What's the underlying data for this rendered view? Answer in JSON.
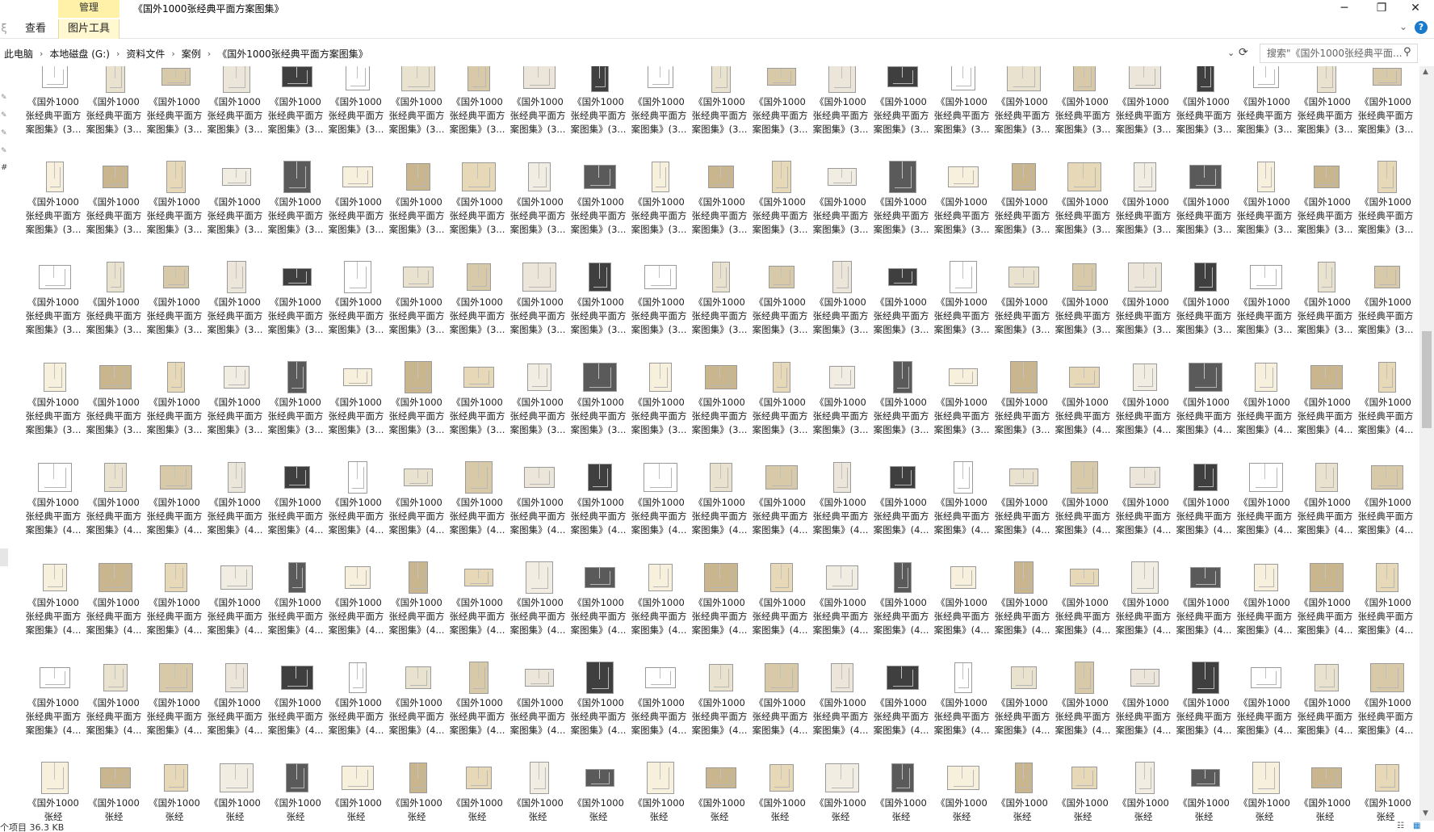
{
  "window": {
    "context_tab": "管理",
    "title": "《国外1000张经典平面方案图集》",
    "minimize": "─",
    "restore": "❐",
    "close": "✕"
  },
  "ribbon": {
    "left_fragment": "ξ",
    "tabs": [
      {
        "label": "查看"
      },
      {
        "label": "图片工具"
      }
    ],
    "expand_glyph": "⌄",
    "help_glyph": "?"
  },
  "address": {
    "crumbs": [
      "此电脑",
      "本地磁盘 (G:)",
      "资料文件",
      "案例",
      "《国外1000张经典平面方案图集》"
    ],
    "separator": "›",
    "dropdown_glyph": "⌄",
    "refresh_glyph": "⟳"
  },
  "search": {
    "placeholder": "搜索\"《国外1000张经典平面...",
    "icon": "⚲"
  },
  "navpane": {
    "pin_glyph": "✎",
    "fragment": "#"
  },
  "gallery": {
    "rows": [
      {
        "captions": [
          "《国外1000张经典平面方案图集》(3...",
          "《国外1000张经典平面方案图集》(3...",
          "《国外1000张经典平面方案图集》(3...",
          "《国外1000张经典平面方案图集》(3...",
          "《国外1000张经典平面方案图集》(3...",
          "《国外1000张经典平面方案图集》(3...",
          "《国外1000张经典平面方案图集》(3...",
          "《国外1000张经典平面方案图集》(3...",
          "《国外1000张经典平面方案图集》(3...",
          "《国外1000张经典平面方案图集》(3...",
          "《国外1000张经典平面方案图集》(3...",
          "《国外1000张经典平面方案图集》(3...",
          "《国外1000张经典平面方案图集》(3...",
          "《国外1000张经典平面方案图集》(3...",
          "《国外1000张经典平面方案图集》(3...",
          "《国外1000张经典平面方案图集》(3...",
          "《国外1000张经典平面方案图集》(3...",
          "《国外1000张经典平面方案图集》(3...",
          "《国外1000张经典平面方案图集》(3...",
          "《国外1000张经典平面方案图集》(3...",
          "《国外1000张经典平面方案图集》(3...",
          "《国外1000张经典平面方案图集》(3...",
          "《国外1000张经典平面方案图集》(3...",
          "《国外1000张经典平面方案图集》(3..."
        ]
      },
      {
        "captions": [
          "《国外1000张经典平面方案图集》(3...",
          "《国外1000张经典平面方案图集》(3...",
          "《国外1000张经典平面方案图集》(3...",
          "《国外1000张经典平面方案图集》(3...",
          "《国外1000张经典平面方案图集》(3...",
          "《国外1000张经典平面方案图集》(3...",
          "《国外1000张经典平面方案图集》(3...",
          "《国外1000张经典平面方案图集》(3...",
          "《国外1000张经典平面方案图集》(3...",
          "《国外1000张经典平面方案图集》(3...",
          "《国外1000张经典平面方案图集》(3...",
          "《国外1000张经典平面方案图集》(3...",
          "《国外1000张经典平面方案图集》(3...",
          "《国外1000张经典平面方案图集》(3...",
          "《国外1000张经典平面方案图集》(3...",
          "《国外1000张经典平面方案图集》(3...",
          "《国外1000张经典平面方案图集》(3...",
          "《国外1000张经典平面方案图集》(3...",
          "《国外1000张经典平面方案图集》(3...",
          "《国外1000张经典平面方案图集》(3...",
          "《国外1000张经典平面方案图集》(3...",
          "《国外1000张经典平面方案图集》(3...",
          "《国外1000张经典平面方案图集》(3...",
          "《国外1000张经典平面方案图集》(3..."
        ]
      },
      {
        "captions": [
          "《国外1000张经典平面方案图集》(3...",
          "《国外1000张经典平面方案图集》(3...",
          "《国外1000张经典平面方案图集》(3...",
          "《国外1000张经典平面方案图集》(3...",
          "《国外1000张经典平面方案图集》(3...",
          "《国外1000张经典平面方案图集》(3...",
          "《国外1000张经典平面方案图集》(3...",
          "《国外1000张经典平面方案图集》(3...",
          "《国外1000张经典平面方案图集》(3...",
          "《国外1000张经典平面方案图集》(3...",
          "《国外1000张经典平面方案图集》(3...",
          "《国外1000张经典平面方案图集》(3...",
          "《国外1000张经典平面方案图集》(3...",
          "《国外1000张经典平面方案图集》(3...",
          "《国外1000张经典平面方案图集》(3...",
          "《国外1000张经典平面方案图集》(3...",
          "《国外1000张经典平面方案图集》(3...",
          "《国外1000张经典平面方案图集》(3...",
          "《国外1000张经典平面方案图集》(3...",
          "《国外1000张经典平面方案图集》(3...",
          "《国外1000张经典平面方案图集》(3...",
          "《国外1000张经典平面方案图集》(3...",
          "《国外1000张经典平面方案图集》(3...",
          "《国外1000张经典平面方案图集》(3..."
        ]
      },
      {
        "captions": [
          "《国外1000张经典平面方案图集》(3...",
          "《国外1000张经典平面方案图集》(3...",
          "《国外1000张经典平面方案图集》(3...",
          "《国外1000张经典平面方案图集》(3...",
          "《国外1000张经典平面方案图集》(3...",
          "《国外1000张经典平面方案图集》(3...",
          "《国外1000张经典平面方案图集》(3...",
          "《国外1000张经典平面方案图集》(3...",
          "《国外1000张经典平面方案图集》(3...",
          "《国外1000张经典平面方案图集》(3...",
          "《国外1000张经典平面方案图集》(3...",
          "《国外1000张经典平面方案图集》(3...",
          "《国外1000张经典平面方案图集》(3...",
          "《国外1000张经典平面方案图集》(3...",
          "《国外1000张经典平面方案图集》(3...",
          "《国外1000张经典平面方案图集》(3...",
          "《国外1000张经典平面方案图集》(3...",
          "《国外1000张经典平面方案图集》(4...",
          "《国外1000张经典平面方案图集》(4...",
          "《国外1000张经典平面方案图集》(4...",
          "《国外1000张经典平面方案图集》(4...",
          "《国外1000张经典平面方案图集》(4...",
          "《国外1000张经典平面方案图集》(4...",
          "《国外1000张经典平面方案图集》(4..."
        ]
      },
      {
        "captions": [
          "《国外1000张经典平面方案图集》(4...",
          "《国外1000张经典平面方案图集》(4...",
          "《国外1000张经典平面方案图集》(4...",
          "《国外1000张经典平面方案图集》(4...",
          "《国外1000张经典平面方案图集》(4...",
          "《国外1000张经典平面方案图集》(4...",
          "《国外1000张经典平面方案图集》(4...",
          "《国外1000张经典平面方案图集》(4...",
          "《国外1000张经典平面方案图集》(4...",
          "《国外1000张经典平面方案图集》(4...",
          "《国外1000张经典平面方案图集》(4...",
          "《国外1000张经典平面方案图集》(4...",
          "《国外1000张经典平面方案图集》(4...",
          "《国外1000张经典平面方案图集》(4...",
          "《国外1000张经典平面方案图集》(4...",
          "《国外1000张经典平面方案图集》(4...",
          "《国外1000张经典平面方案图集》(4...",
          "《国外1000张经典平面方案图集》(4...",
          "《国外1000张经典平面方案图集》(4...",
          "《国外1000张经典平面方案图集》(4...",
          "《国外1000张经典平面方案图集》(4...",
          "《国外1000张经典平面方案图集》(4...",
          "《国外1000张经典平面方案图集》(4...",
          "《国外1000张经典平面方案图集》(4..."
        ]
      },
      {
        "captions": [
          "《国外1000张经典平面方案图集》(4...",
          "《国外1000张经典平面方案图集》(4...",
          "《国外1000张经典平面方案图集》(4...",
          "《国外1000张经典平面方案图集》(4...",
          "《国外1000张经典平面方案图集》(4...",
          "《国外1000张经典平面方案图集》(4...",
          "《国外1000张经典平面方案图集》(4...",
          "《国外1000张经典平面方案图集》(4...",
          "《国外1000张经典平面方案图集》(4...",
          "《国外1000张经典平面方案图集》(4...",
          "《国外1000张经典平面方案图集》(4...",
          "《国外1000张经典平面方案图集》(4...",
          "《国外1000张经典平面方案图集》(4...",
          "《国外1000张经典平面方案图集》(4...",
          "《国外1000张经典平面方案图集》(4...",
          "《国外1000张经典平面方案图集》(4...",
          "《国外1000张经典平面方案图集》(4...",
          "《国外1000张经典平面方案图集》(4...",
          "《国外1000张经典平面方案图集》(4...",
          "《国外1000张经典平面方案图集》(4...",
          "《国外1000张经典平面方案图集》(4...",
          "《国外1000张经典平面方案图集》(4...",
          "《国外1000张经典平面方案图集》(4...",
          "《国外1000张经典平面方案图集》(4..."
        ]
      },
      {
        "captions": [
          "《国外1000张经典平面方案图集》(4...",
          "《国外1000张经典平面方案图集》(4...",
          "《国外1000张经典平面方案图集》(4...",
          "《国外1000张经典平面方案图集》(4...",
          "《国外1000张经典平面方案图集》(4...",
          "《国外1000张经典平面方案图集》(4...",
          "《国外1000张经典平面方案图集》(4...",
          "《国外1000张经典平面方案图集》(4...",
          "《国外1000张经典平面方案图集》(4...",
          "《国外1000张经典平面方案图集》(4...",
          "《国外1000张经典平面方案图集》(4...",
          "《国外1000张经典平面方案图集》(4...",
          "《国外1000张经典平面方案图集》(4...",
          "《国外1000张经典平面方案图集》(4...",
          "《国外1000张经典平面方案图集》(4...",
          "《国外1000张经典平面方案图集》(4...",
          "《国外1000张经典平面方案图集》(4...",
          "《国外1000张经典平面方案图集》(4...",
          "《国外1000张经典平面方案图集》(4...",
          "《国外1000张经典平面方案图集》(4...",
          "《国外1000张经典平面方案图集》(4...",
          "《国外1000张经典平面方案图集》(4...",
          "《国外1000张经典平面方案图集》(4...",
          "《国外1000张经典平面方案图集》(4..."
        ]
      },
      {
        "captions": [
          "《国外1000张经",
          "《国外1000张经",
          "《国外1000张经",
          "《国外1000张经",
          "《国外1000张经",
          "《国外1000张经",
          "《国外1000张经",
          "《国外1000张经",
          "《国外1000张经",
          "《国外1000张经",
          "《国外1000张经",
          "《国外1000张经",
          "《国外1000张经",
          "《国外1000张经",
          "《国外1000张经",
          "《国外1000张经",
          "《国外1000张经",
          "《国外1000张经",
          "《国外1000张经",
          "《国外1000张经",
          "《国外1000张经",
          "《国外1000张经",
          "《国外1000张经",
          "《国外1000张经"
        ]
      }
    ]
  },
  "status": {
    "text": "个项目  36.3 KB",
    "details_glyph": "☷",
    "thumbs_glyph": "▦"
  },
  "colors": {
    "context_tab_bg": "#fff2a8",
    "accent": "#1979ca"
  },
  "scroll": {
    "up_glyph": "▲",
    "down_glyph": "▼"
  }
}
